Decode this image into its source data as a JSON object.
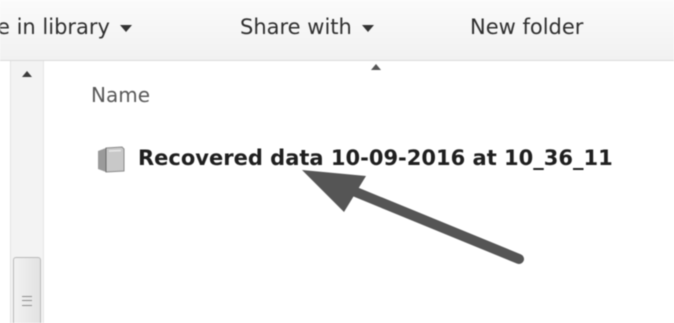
{
  "toolbar": {
    "include_in_library": "e in library",
    "share_with": "Share with",
    "new_folder": "New folder"
  },
  "file_list": {
    "columns": [
      "Name"
    ],
    "items": [
      {
        "name": "Recovered data 10-09-2016 at 10_36_11",
        "icon": "folder-icon"
      }
    ]
  },
  "icons": {
    "toolbar_dropdown": "chevron-down-icon",
    "sort_indicator": "sort-up-icon",
    "scroll_up": "scroll-up-icon",
    "annotation": "arrow-icon"
  },
  "colors": {
    "toolbar_bg": "#f0f1f2",
    "header_text": "#4f5b66",
    "annotation_arrow": "#555555"
  }
}
